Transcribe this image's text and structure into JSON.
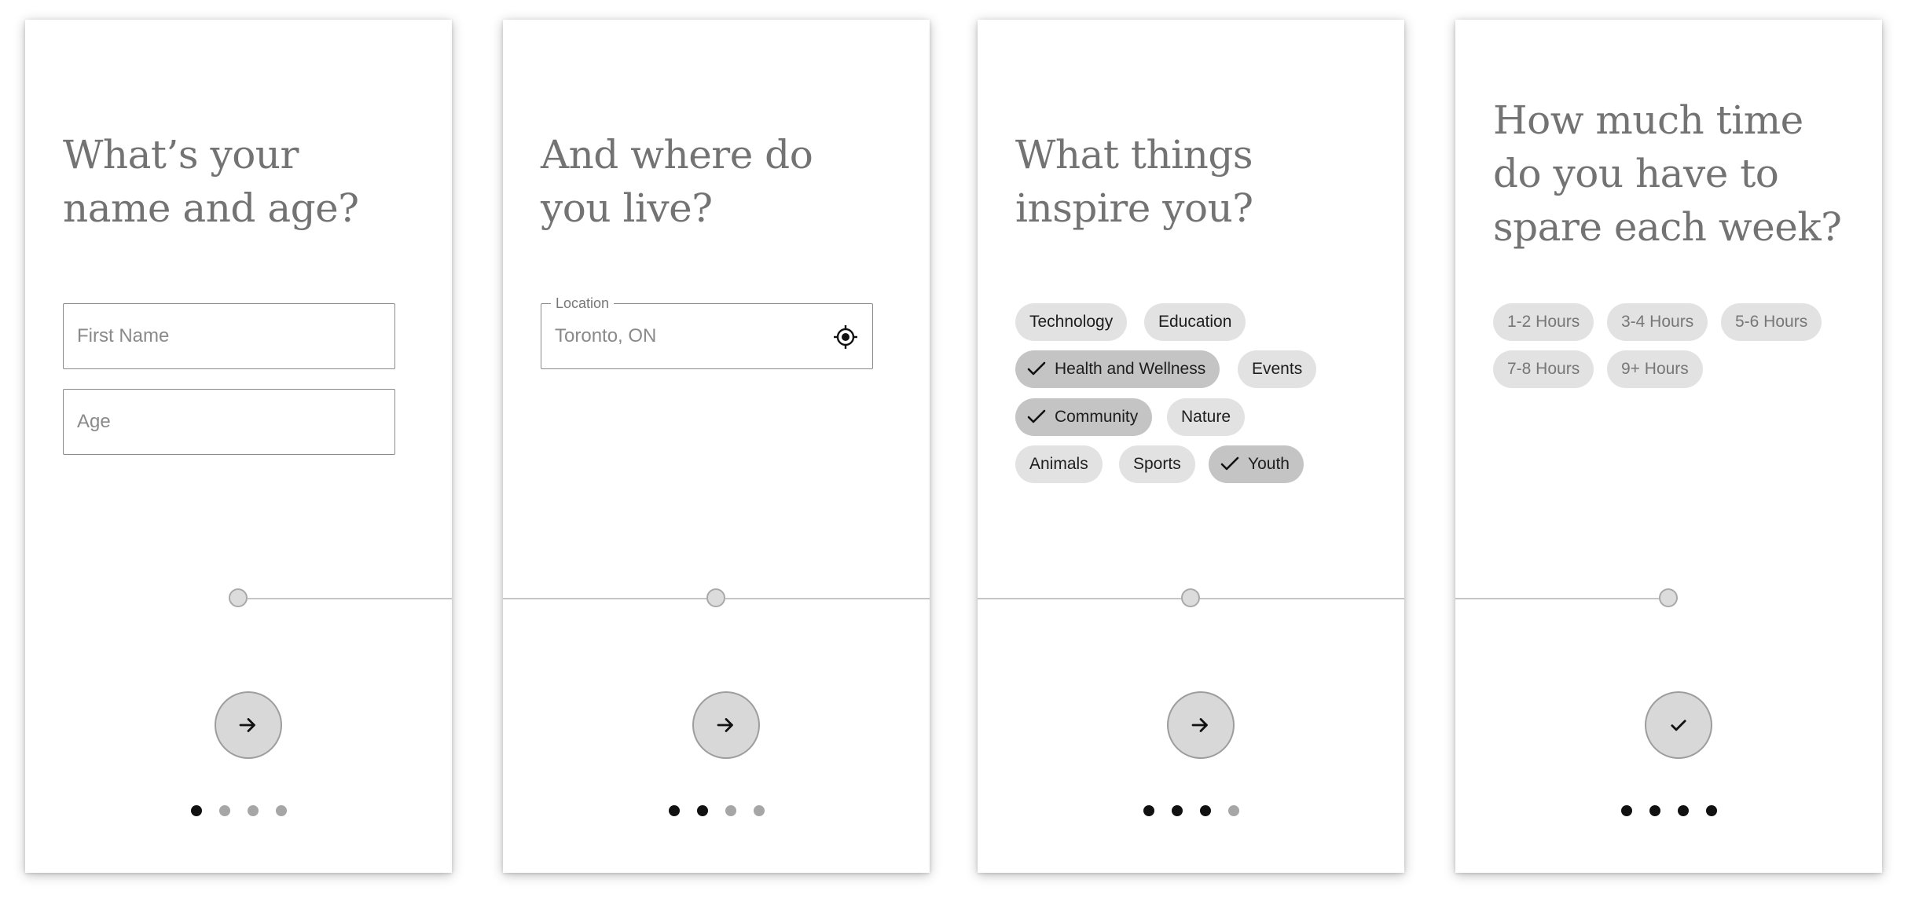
{
  "screens": [
    {
      "title_line1": "What’s your",
      "title_line2": "name and age?",
      "fields": [
        {
          "placeholder": "First Name"
        },
        {
          "placeholder": "Age"
        }
      ],
      "progress_step": 1,
      "total_steps": 4
    },
    {
      "title_line1": "And where do",
      "title_line2": "you live?",
      "location": {
        "label": "Location",
        "value": "Toronto, ON",
        "icon": "gps-locate-icon"
      },
      "progress_step": 2,
      "total_steps": 4
    },
    {
      "title_line1": "What things",
      "title_line2": "inspire you?",
      "chips": [
        {
          "label": "Technology",
          "selected": false
        },
        {
          "label": "Education",
          "selected": false
        },
        {
          "label": "Health and Wellness",
          "selected": true
        },
        {
          "label": "Events",
          "selected": false
        },
        {
          "label": "Community",
          "selected": true
        },
        {
          "label": "Nature",
          "selected": false
        },
        {
          "label": "Animals",
          "selected": false
        },
        {
          "label": "Sports",
          "selected": false
        },
        {
          "label": "Youth",
          "selected": true
        }
      ],
      "progress_step": 3,
      "total_steps": 4
    },
    {
      "title_line1": "How much time",
      "title_line2": "do you have to",
      "title_line3": "spare each week?",
      "chips": [
        {
          "label": "1-2 Hours",
          "selected": false
        },
        {
          "label": "3-4 Hours",
          "selected": false
        },
        {
          "label": "5-6 Hours",
          "selected": false
        },
        {
          "label": "7-8 Hours",
          "selected": false
        },
        {
          "label": "9+ Hours",
          "selected": false
        }
      ],
      "progress_step": 4,
      "total_steps": 4
    }
  ],
  "buttons": {
    "next_icon": "arrow-right-icon",
    "finish_icon": "check-icon"
  },
  "colors": {
    "title": "#737373",
    "chip": "#e2e2e2",
    "chip_selected": "#c4c4c4",
    "dot_active": "#111111",
    "dot_inactive": "#a6a6a6"
  }
}
